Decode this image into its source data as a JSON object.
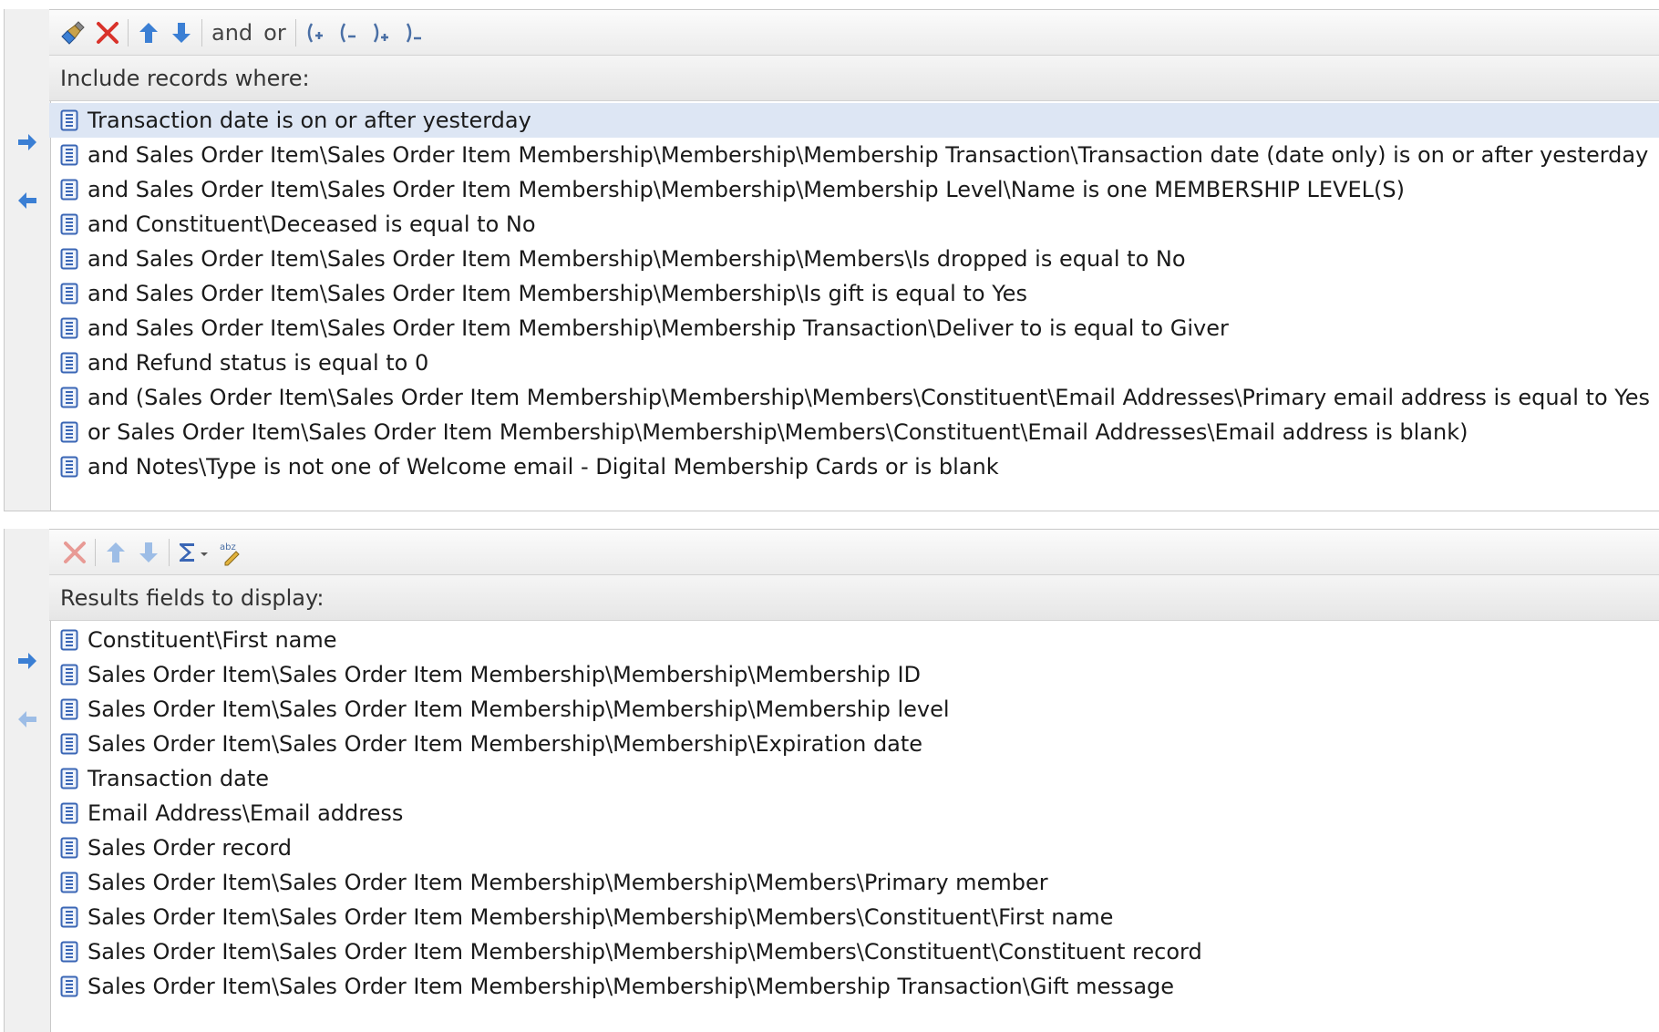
{
  "filters": {
    "toolbar": {
      "and_label": "and",
      "or_label": "or"
    },
    "header": "Include records where:",
    "rows": [
      "Transaction date is on or after yesterday",
      "and Sales Order Item\\Sales Order Item Membership\\Membership\\Membership Transaction\\Transaction date (date only) is on or after yesterday",
      "and Sales Order Item\\Sales Order Item Membership\\Membership\\Membership Level\\Name is one MEMBERSHIP LEVEL(S)",
      "and Constituent\\Deceased is equal to No",
      "and Sales Order Item\\Sales Order Item Membership\\Membership\\Members\\Is dropped is equal to No",
      "and Sales Order Item\\Sales Order Item Membership\\Membership\\Is gift is equal to Yes",
      "and Sales Order Item\\Sales Order Item Membership\\Membership Transaction\\Deliver to is equal to Giver",
      "and Refund status is equal to 0",
      "and (Sales Order Item\\Sales Order Item Membership\\Membership\\Members\\Constituent\\Email Addresses\\Primary email address is equal to Yes",
      "or Sales Order Item\\Sales Order Item Membership\\Membership\\Members\\Constituent\\Email Addresses\\Email address is blank)",
      "and Notes\\Type is not one of Welcome email - Digital Membership Cards or is blank"
    ]
  },
  "results": {
    "header": "Results fields to display:",
    "rows": [
      "Constituent\\First name",
      "Sales Order Item\\Sales Order Item Membership\\Membership\\Membership ID",
      "Sales Order Item\\Sales Order Item Membership\\Membership\\Membership level",
      "Sales Order Item\\Sales Order Item Membership\\Membership\\Expiration date",
      "Transaction date",
      "Email Address\\Email address",
      "Sales Order record",
      "Sales Order Item\\Sales Order Item Membership\\Membership\\Members\\Primary member",
      "Sales Order Item\\Sales Order Item Membership\\Membership\\Members\\Constituent\\First name",
      "Sales Order Item\\Sales Order Item Membership\\Membership\\Members\\Constituent\\Constituent record",
      "Sales Order Item\\Sales Order Item Membership\\Membership\\Membership Transaction\\Gift message"
    ]
  },
  "colors": {
    "accent": "#3b7fd4",
    "delete": "#d9322a",
    "selected_row": "#dde6f4"
  }
}
